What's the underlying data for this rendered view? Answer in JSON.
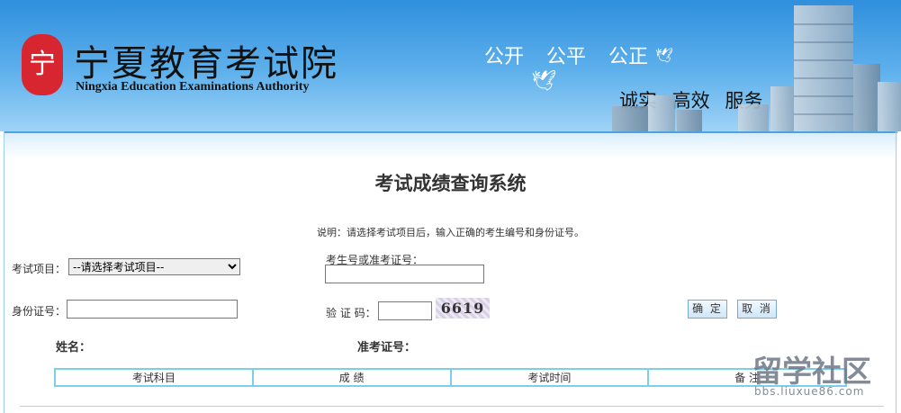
{
  "header": {
    "seal_glyph": "宁",
    "logo_cn": "宁夏教育考试院",
    "logo_en": "Ningxia Education Examinations Authority",
    "slogan_top": "公开  公平  公正",
    "slogan_bottom": "诚实  高效  服务"
  },
  "page": {
    "title": "考试成绩查询系统",
    "note": "说明：请选择考试项目后，输入正确的考生编号和身份证号。"
  },
  "form": {
    "exam_label": "考试项目：",
    "exam_selected": "--请选择考试项目--",
    "candidate_label": "考生号或准考证号：",
    "candidate_value": "",
    "id_label": "身份证号：",
    "id_value": "",
    "captcha_label": "验 证 码：",
    "captcha_value": "",
    "captcha_text": "6619",
    "confirm_label": "确 定",
    "cancel_label": "取 消"
  },
  "result": {
    "name_label": "姓名：",
    "ticket_label": "准考证号：",
    "columns": [
      "考试科目",
      "成 绩",
      "考试时间",
      "备 注"
    ]
  },
  "watermark": {
    "main": "留学社区",
    "url": "bbs.liuxue86.com"
  }
}
